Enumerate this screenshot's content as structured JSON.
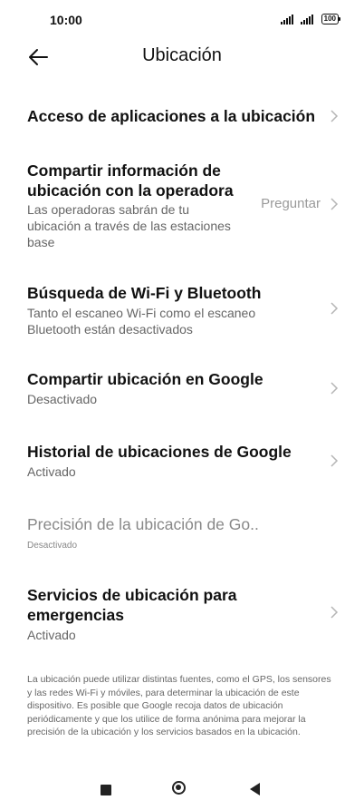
{
  "status_bar": {
    "time": "10:00",
    "battery": "100"
  },
  "header": {
    "title": "Ubicación"
  },
  "items": [
    {
      "title": "Acceso de aplicaciones a la ubicación"
    },
    {
      "title_line1": "Compartir información de",
      "title_line2": "ubicación con la operadora",
      "sub_line1": "Las operadoras sabrán de tu",
      "sub_line2": "ubicación a través de las estaciones",
      "sub_line3": "base",
      "value": "Preguntar"
    },
    {
      "title": "Búsqueda de Wi-Fi y Bluetooth",
      "sub_line1": "Tanto el escaneo Wi-Fi como el escaneo",
      "sub_line2": "Bluetooth están desactivados"
    },
    {
      "title": "Compartir ubicación en Google",
      "sub": "Desactivado"
    },
    {
      "title": "Historial de ubicaciones de Google",
      "sub": "Activado"
    },
    {
      "title": "Precisión de la ubicación de Go..",
      "sub": "Desactivado"
    },
    {
      "title_line1": "Servicios de ubicación para",
      "title_line2": "emergencias",
      "sub": "Activado"
    }
  ],
  "footer_note": "La ubicación puede utilizar distintas fuentes, como el GPS, los sensores y las redes Wi-Fi y móviles, para determinar la ubicación de este dispositivo. Es posible que Google recoja datos de ubicación periódicamente y que los utilice de forma anónima para mejorar la precisión de la ubicación y los servicios basados en la ubicación.",
  "icons": {
    "back": "arrow-left-icon",
    "chevron": "chevron-right-icon",
    "nav_recents": "square-icon",
    "nav_home": "circle-icon",
    "nav_back": "triangle-back-icon"
  }
}
